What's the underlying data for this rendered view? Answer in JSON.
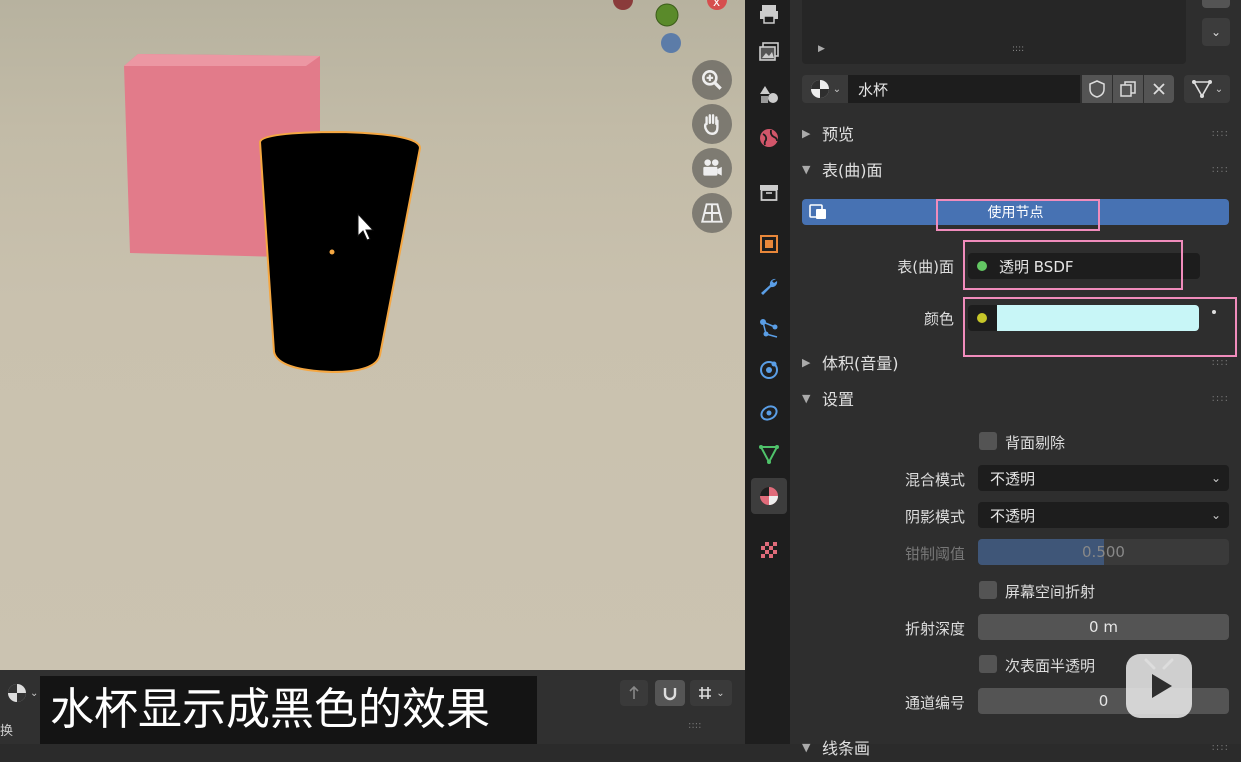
{
  "viewport": {
    "material_name": "水杯",
    "subtitle": "水杯显示成黑色的效果",
    "partial_label": "换"
  },
  "properties": {
    "material_selector": {
      "name": "水杯"
    },
    "sections": {
      "preview": "预览",
      "surface": "表(曲)面",
      "volume": "体积(音量)",
      "settings": "设置",
      "lineart": "线条画"
    },
    "use_nodes_button": "使用节点",
    "surface_field": {
      "label": "表(曲)面",
      "value": "透明 BSDF"
    },
    "color_field": {
      "label": "颜色",
      "swatch": "#c8f6f7"
    },
    "settings": {
      "backface_culling": "背面剔除",
      "blend_mode_label": "混合模式",
      "blend_mode_value": "不透明",
      "shadow_mode_label": "阴影模式",
      "shadow_mode_value": "不透明",
      "clip_threshold_label": "钳制阈值",
      "clip_threshold_value": "0.500",
      "clip_threshold_fraction": 0.5,
      "screen_space_refraction": "屏幕空间折射",
      "refraction_depth_label": "折射深度",
      "refraction_depth_value": "0 m",
      "subsurface_translucency": "次表面半透明",
      "pass_index_label": "通道编号",
      "pass_index_value": "0"
    }
  },
  "colors": {
    "accent_blue": "#4772b3",
    "highlight_pink": "#f08cbc",
    "cube_pink": "#e27b8a",
    "selection_orange": "#f5a742",
    "socket_green": "#63c763",
    "socket_yellow": "#c7c729"
  }
}
